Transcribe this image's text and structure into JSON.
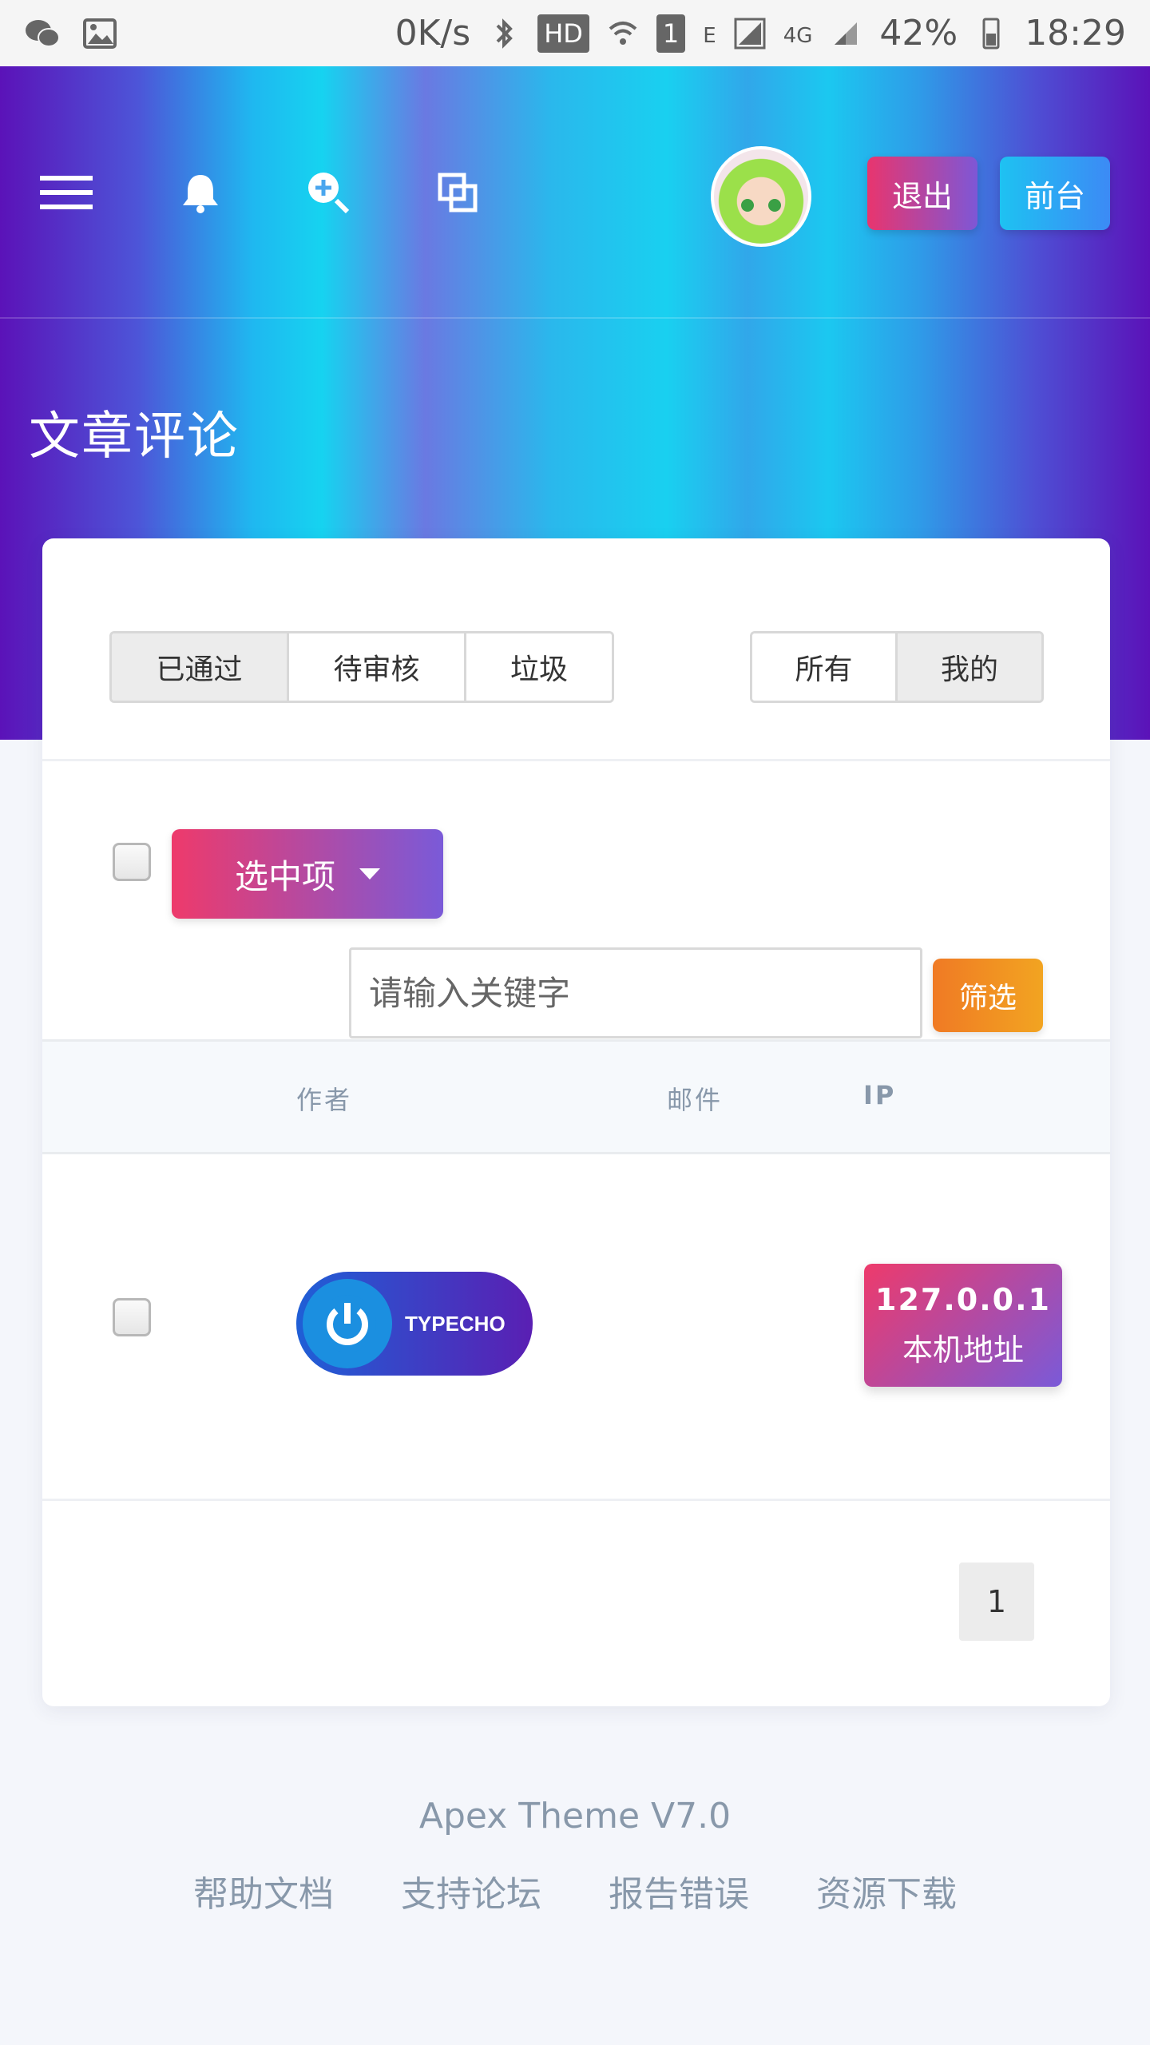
{
  "statusbar": {
    "net_speed": "0K/s",
    "hd": "HD",
    "sim": "1",
    "edge": "E",
    "lte": "4G",
    "battery": "42%",
    "time": "18:29"
  },
  "header": {
    "logout_label": "退出",
    "frontend_label": "前台",
    "page_title": "文章评论"
  },
  "filters": {
    "status_tabs": [
      {
        "label": "已通过",
        "active": true
      },
      {
        "label": "待审核",
        "active": false
      },
      {
        "label": "垃圾",
        "active": false
      }
    ],
    "scope_tabs": [
      {
        "label": "所有",
        "active": false
      },
      {
        "label": "我的",
        "active": true
      }
    ]
  },
  "toolbar": {
    "select_label": "选中项",
    "search_placeholder": "请输入关键字",
    "filter_label": "筛选"
  },
  "table": {
    "columns": [
      "作者",
      "邮件",
      "IP"
    ],
    "rows": [
      {
        "author_badge": "TYPECHO",
        "email": "",
        "ip": "127.0.0.1",
        "ip_desc": "本机地址"
      }
    ]
  },
  "pagination": {
    "current_page": "1"
  },
  "footer": {
    "version": "Apex Theme V7.0",
    "links": [
      "帮助文档",
      "支持论坛",
      "报告错误",
      "资源下载"
    ]
  },
  "colors": {
    "primary_gradient_start": "#ee3a6b",
    "primary_gradient_end": "#7a5ad8",
    "info": "#1ec2f2",
    "warning": "#f07a24",
    "header_purple": "#5b12b8",
    "header_cyan": "#16d3f0"
  }
}
